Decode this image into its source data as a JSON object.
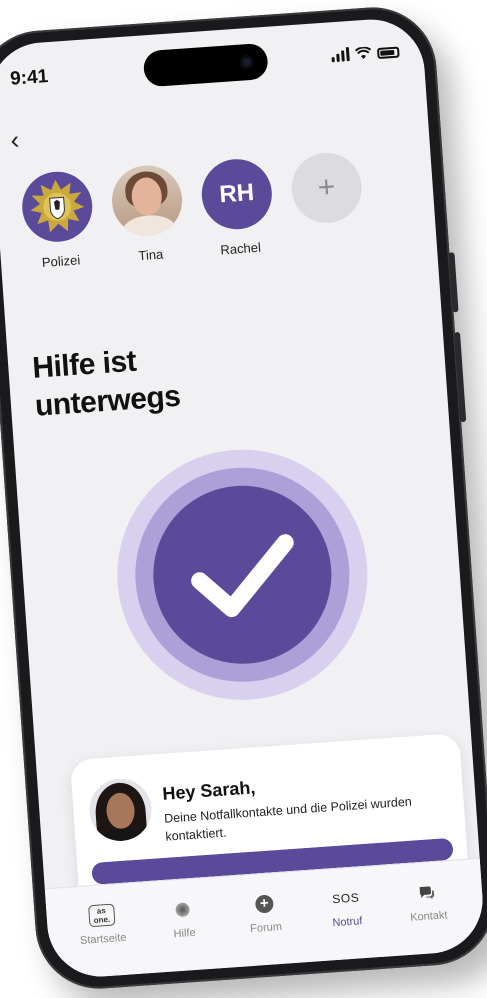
{
  "status": {
    "time": "9:41"
  },
  "contacts": [
    {
      "name": "Polizei",
      "type": "police"
    },
    {
      "name": "Tina",
      "type": "photo"
    },
    {
      "name": "Rachel",
      "type": "initials",
      "initials": "RH"
    },
    {
      "name": "",
      "type": "add",
      "symbol": "+"
    }
  ],
  "headline": {
    "line1": "Hilfe ist",
    "line2": "unterwegs"
  },
  "card": {
    "title": "Hey Sarah,",
    "message": "Deine Notfallkontakte und die Polizei wurden kontaktiert.",
    "progress": 1.0
  },
  "tabs": [
    {
      "label": "Startseite",
      "icon": "as-one-logo-icon",
      "logo_text": "as one."
    },
    {
      "label": "Hilfe",
      "icon": "dot-icon"
    },
    {
      "label": "Forum",
      "icon": "plus-circle-icon"
    },
    {
      "label": "Notruf",
      "icon": "sos-icon",
      "icon_text": "SOS",
      "active": true
    },
    {
      "label": "Kontakt",
      "icon": "chat-bubbles-icon"
    }
  ],
  "colors": {
    "accent": "#5b4a9a",
    "ring_mid": "#ad9fd8",
    "ring_outer": "#d8d0ee",
    "background": "#f1f0f3"
  }
}
